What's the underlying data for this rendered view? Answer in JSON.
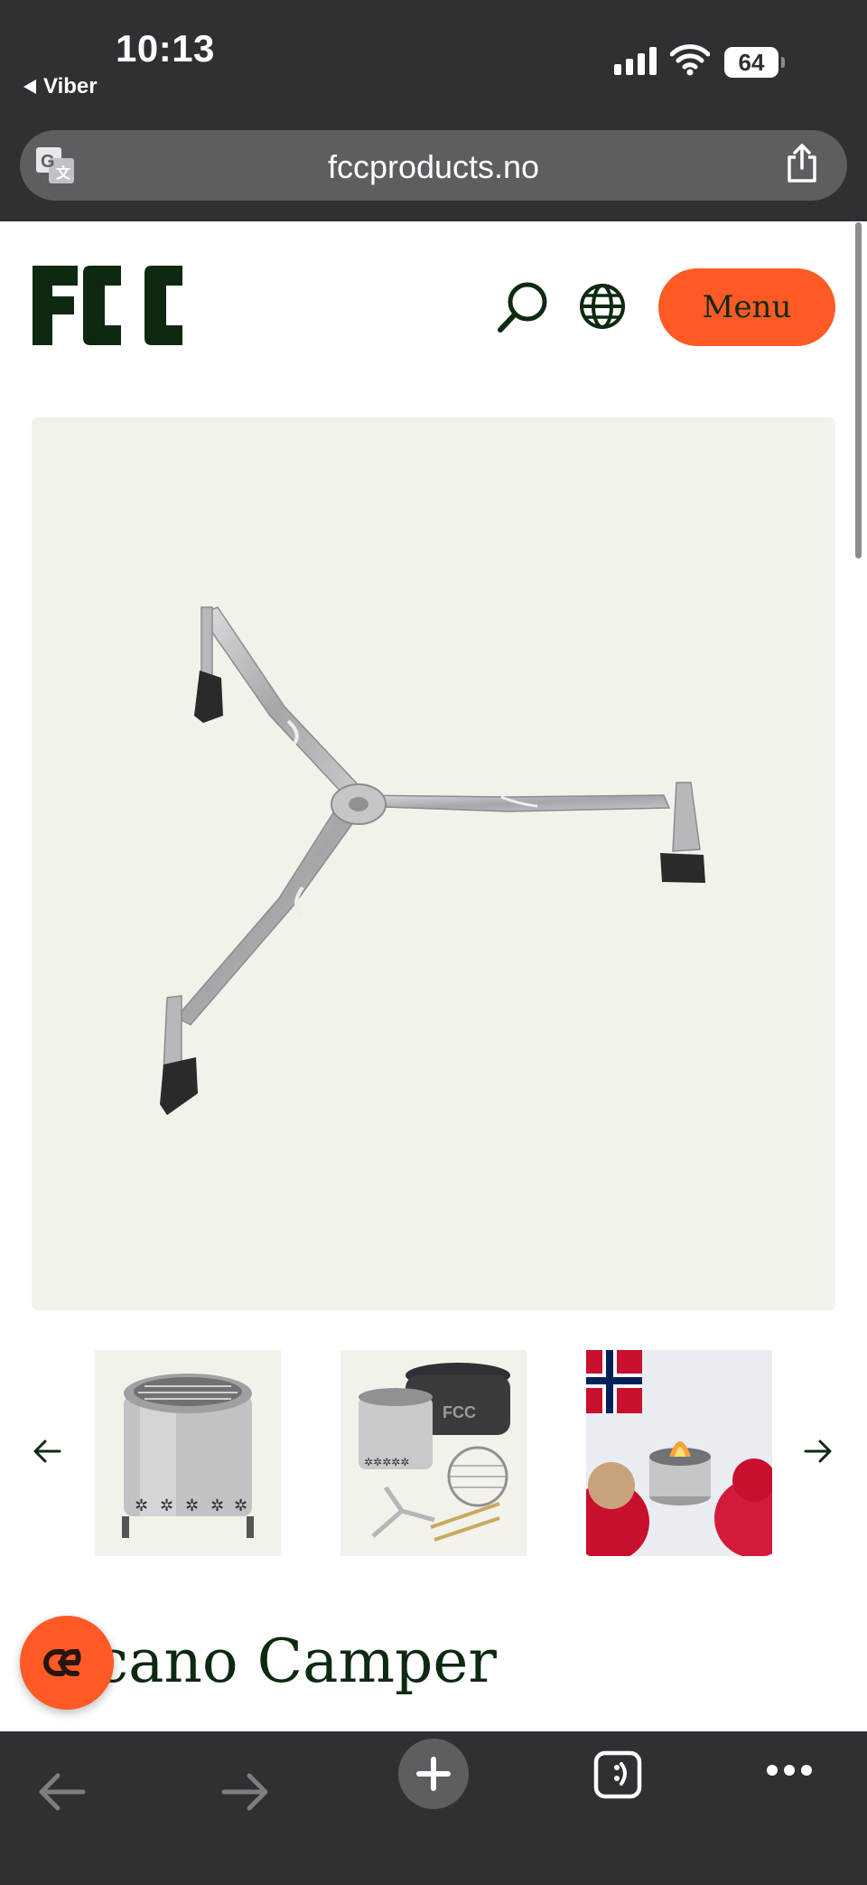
{
  "status_bar": {
    "time": "10:13",
    "back_app": "Viber",
    "battery": "64"
  },
  "browser": {
    "url": "fccproducts.no",
    "icons": {
      "translate": "translate-icon",
      "share": "share-icon"
    }
  },
  "header": {
    "logo": "FCC",
    "menu_label": "Menu",
    "icons": [
      "search-icon",
      "globe-icon"
    ],
    "colors": {
      "accent": "#ff5a26",
      "brand_green": "#0d2a10"
    }
  },
  "product": {
    "title": "lcano Camper",
    "hero_image": "stainless steel tripod stand",
    "thumbnails": [
      "fire pit with grill",
      "fire pit kit with bag, grate and stand",
      "fire pit with children and Norwegian flags"
    ]
  },
  "toolbar": {
    "icons": [
      "back-icon",
      "forward-icon",
      "new-tab-icon",
      "tabs-icon",
      "more-icon"
    ]
  }
}
